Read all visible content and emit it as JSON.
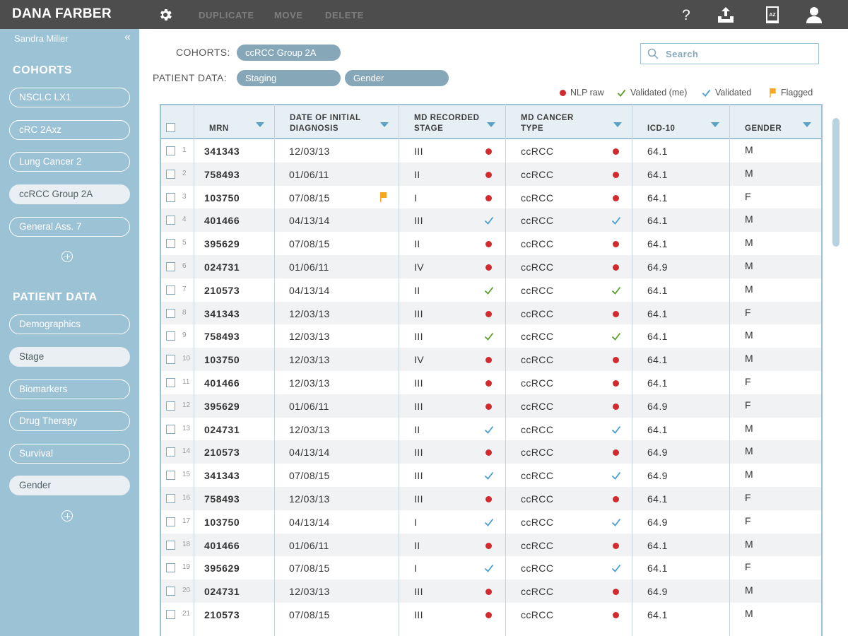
{
  "app": {
    "brand": "DANA FARBER"
  },
  "toolbar": {
    "actions": [
      "DUPLICATE",
      "MOVE",
      "DELETE"
    ],
    "right_icons": [
      "help-icon",
      "export-icon",
      "dictionary-icon",
      "user-icon"
    ],
    "dictionary_badge": "AZ"
  },
  "sidebar": {
    "user": "Sandra Miller",
    "collapse_glyph": "«",
    "cohorts_title": "COHORTS",
    "cohorts": [
      {
        "label": "NSCLC LX1",
        "active": false
      },
      {
        "label": "cRC 2Axz",
        "active": false
      },
      {
        "label": "Lung Cancer 2",
        "active": false
      },
      {
        "label": "ccRCC Group 2A",
        "active": true
      },
      {
        "label": "General Ass. 7",
        "active": false
      }
    ],
    "patient_data_title": "PATIENT DATA",
    "patient_data": [
      {
        "label": "Demographics",
        "active": false
      },
      {
        "label": "Stage",
        "active": true
      },
      {
        "label": "Biomarkers",
        "active": false
      },
      {
        "label": "Drug Therapy",
        "active": false
      },
      {
        "label": "Survival",
        "active": false
      },
      {
        "label": "Gender",
        "active": true
      }
    ]
  },
  "filters": {
    "cohorts_label": "COHORTS:",
    "cohort_tags": [
      "ccRCC Group 2A"
    ],
    "patient_data_label": "PATIENT DATA:",
    "patient_data_tags": [
      "Staging",
      "Gender"
    ]
  },
  "search": {
    "placeholder": "Search"
  },
  "legend": [
    {
      "label": "NLP raw",
      "marker": "dot",
      "color": "#d12a2f"
    },
    {
      "label": "Validated (me)",
      "marker": "check",
      "color": "#5aa02c"
    },
    {
      "label": "Validated",
      "marker": "check",
      "color": "#4a9fd0"
    },
    {
      "label": "Flagged",
      "marker": "flag",
      "color": "#f5a623"
    }
  ],
  "colors": {
    "nlp": "#d12a2f",
    "validated_me": "#5aa02c",
    "validated": "#4a9fd0",
    "flagged": "#f5a623",
    "sidebar": "#9cc2d5",
    "topbar": "#4d4d4d"
  },
  "table": {
    "columns": [
      {
        "key": "mrn",
        "label": [
          "MRN"
        ]
      },
      {
        "key": "date",
        "label": [
          "DATE OF INITIAL",
          "DIAGNOSIS"
        ]
      },
      {
        "key": "stage",
        "label": [
          "MD RECORDED",
          "STAGE"
        ]
      },
      {
        "key": "type",
        "label": [
          "MD CANCER",
          "TYPE"
        ]
      },
      {
        "key": "icd",
        "label": [
          "ICD-10"
        ]
      },
      {
        "key": "gender",
        "label": [
          "GENDER"
        ]
      }
    ],
    "rows": [
      {
        "n": 1,
        "mrn": "341343",
        "date": "12/03/13",
        "stage": "III",
        "stage_status": "nlp",
        "type": "ccRCC",
        "type_status": "nlp",
        "icd": "64.1",
        "gender": "M"
      },
      {
        "n": 2,
        "mrn": "758493",
        "date": "01/06/11",
        "stage": "II",
        "stage_status": "nlp",
        "type": "ccRCC",
        "type_status": "nlp",
        "icd": "64.1",
        "gender": "M"
      },
      {
        "n": 3,
        "mrn": "103750",
        "date": "07/08/15",
        "date_flag": true,
        "stage": "I",
        "stage_status": "nlp",
        "type": "ccRCC",
        "type_status": "nlp",
        "icd": "64.1",
        "gender": "F"
      },
      {
        "n": 4,
        "mrn": "401466",
        "date": "04/13/14",
        "stage": "III",
        "stage_status": "validated",
        "type": "ccRCC",
        "type_status": "validated",
        "icd": "64.1",
        "gender": "M"
      },
      {
        "n": 5,
        "mrn": "395629",
        "date": "07/08/15",
        "stage": "II",
        "stage_status": "nlp",
        "type": "ccRCC",
        "type_status": "nlp",
        "icd": "64.1",
        "gender": "M"
      },
      {
        "n": 6,
        "mrn": "024731",
        "date": "01/06/11",
        "stage": "IV",
        "stage_status": "nlp",
        "type": "ccRCC",
        "type_status": "nlp",
        "icd": "64.9",
        "gender": "M"
      },
      {
        "n": 7,
        "mrn": "210573",
        "date": "04/13/14",
        "stage": "II",
        "stage_status": "validated_me",
        "type": "ccRCC",
        "type_status": "validated_me",
        "icd": "64.1",
        "gender": "M"
      },
      {
        "n": 8,
        "mrn": "341343",
        "date": "12/03/13",
        "stage": "III",
        "stage_status": "nlp",
        "type": "ccRCC",
        "type_status": "nlp",
        "icd": "64.1",
        "gender": "F"
      },
      {
        "n": 9,
        "mrn": "758493",
        "date": "12/03/13",
        "stage": "III",
        "stage_status": "validated_me",
        "type": "ccRCC",
        "type_status": "validated_me",
        "icd": "64.1",
        "gender": "M"
      },
      {
        "n": 10,
        "mrn": "103750",
        "date": "12/03/13",
        "stage": "IV",
        "stage_status": "nlp",
        "type": "ccRCC",
        "type_status": "nlp",
        "icd": "64.1",
        "gender": "M"
      },
      {
        "n": 11,
        "mrn": "401466",
        "date": "12/03/13",
        "stage": "III",
        "stage_status": "nlp",
        "type": "ccRCC",
        "type_status": "nlp",
        "icd": "64.1",
        "gender": "F"
      },
      {
        "n": 12,
        "mrn": "395629",
        "date": "01/06/11",
        "stage": "III",
        "stage_status": "nlp",
        "type": "ccRCC",
        "type_status": "nlp",
        "icd": "64.9",
        "gender": "F"
      },
      {
        "n": 13,
        "mrn": "024731",
        "date": "12/03/13",
        "stage": "II",
        "stage_status": "validated",
        "type": "ccRCC",
        "type_status": "validated",
        "icd": "64.1",
        "gender": "M"
      },
      {
        "n": 14,
        "mrn": "210573",
        "date": "04/13/14",
        "stage": "III",
        "stage_status": "nlp",
        "type": "ccRCC",
        "type_status": "nlp",
        "icd": "64.9",
        "gender": "M"
      },
      {
        "n": 15,
        "mrn": "341343",
        "date": "07/08/15",
        "stage": "III",
        "stage_status": "validated",
        "type": "ccRCC",
        "type_status": "validated",
        "icd": "64.9",
        "gender": "M"
      },
      {
        "n": 16,
        "mrn": "758493",
        "date": "12/03/13",
        "stage": "III",
        "stage_status": "nlp",
        "type": "ccRCC",
        "type_status": "nlp",
        "icd": "64.1",
        "gender": "F"
      },
      {
        "n": 17,
        "mrn": "103750",
        "date": "04/13/14",
        "stage": "I",
        "stage_status": "validated",
        "type": "ccRCC",
        "type_status": "validated",
        "icd": "64.9",
        "gender": "F"
      },
      {
        "n": 18,
        "mrn": "401466",
        "date": "01/06/11",
        "stage": "II",
        "stage_status": "nlp",
        "type": "ccRCC",
        "type_status": "nlp",
        "icd": "64.1",
        "gender": "M"
      },
      {
        "n": 19,
        "mrn": "395629",
        "date": "07/08/15",
        "stage": "I",
        "stage_status": "validated",
        "type": "ccRCC",
        "type_status": "validated",
        "icd": "64.1",
        "gender": "F"
      },
      {
        "n": 20,
        "mrn": "024731",
        "date": "12/03/13",
        "stage": "III",
        "stage_status": "nlp",
        "type": "ccRCC",
        "type_status": "nlp",
        "icd": "64.9",
        "gender": "M"
      },
      {
        "n": 21,
        "mrn": "210573",
        "date": "07/08/15",
        "stage": "III",
        "stage_status": "nlp",
        "type": "ccRCC",
        "type_status": "nlp",
        "icd": "64.1",
        "gender": "M"
      }
    ]
  }
}
